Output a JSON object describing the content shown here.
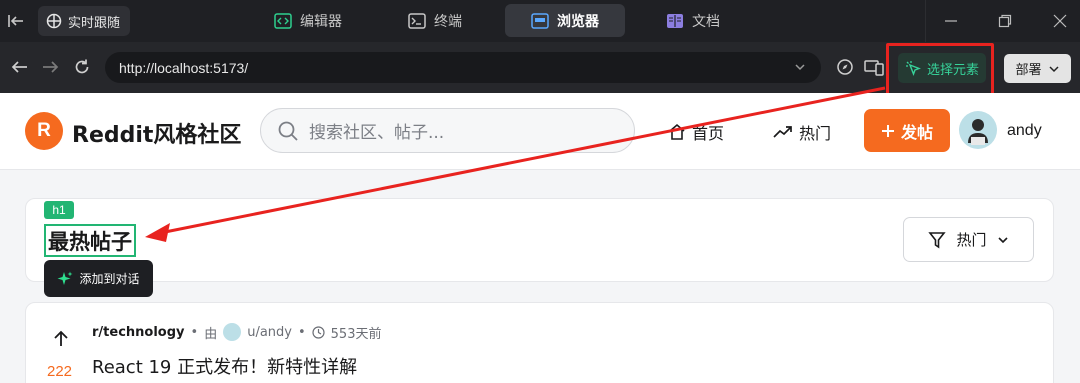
{
  "ide": {
    "follow_label": "实时跟随",
    "tabs": [
      {
        "label": "编辑器",
        "icon": "code-icon"
      },
      {
        "label": "终端",
        "icon": "terminal-icon"
      },
      {
        "label": "浏览器",
        "icon": "browser-icon",
        "active": true
      },
      {
        "label": "文档",
        "icon": "document-icon"
      }
    ]
  },
  "browser": {
    "url": "http://localhost:5173/",
    "select_element_label": "选择元素",
    "deploy_label": "部署"
  },
  "site": {
    "logo_letter": "R",
    "brand": "Reddit风格社区",
    "search_placeholder": "搜索社区、帖子...",
    "nav_home": "首页",
    "nav_hot": "热门",
    "post_button": "发帖",
    "username": "andy"
  },
  "feed": {
    "tag": "h1",
    "title": "最热帖子",
    "add_to_chat": "添加到对话",
    "sort_label": "热门"
  },
  "post": {
    "votes": "222",
    "subreddit": "r/technology",
    "by": "由",
    "author": "u/andy",
    "age": "553天前",
    "title": "React 19 正式发布！新特性详解"
  },
  "colors": {
    "accent": "#f56a1f",
    "select_green": "#22b573",
    "highlight_red": "#e8231f"
  }
}
